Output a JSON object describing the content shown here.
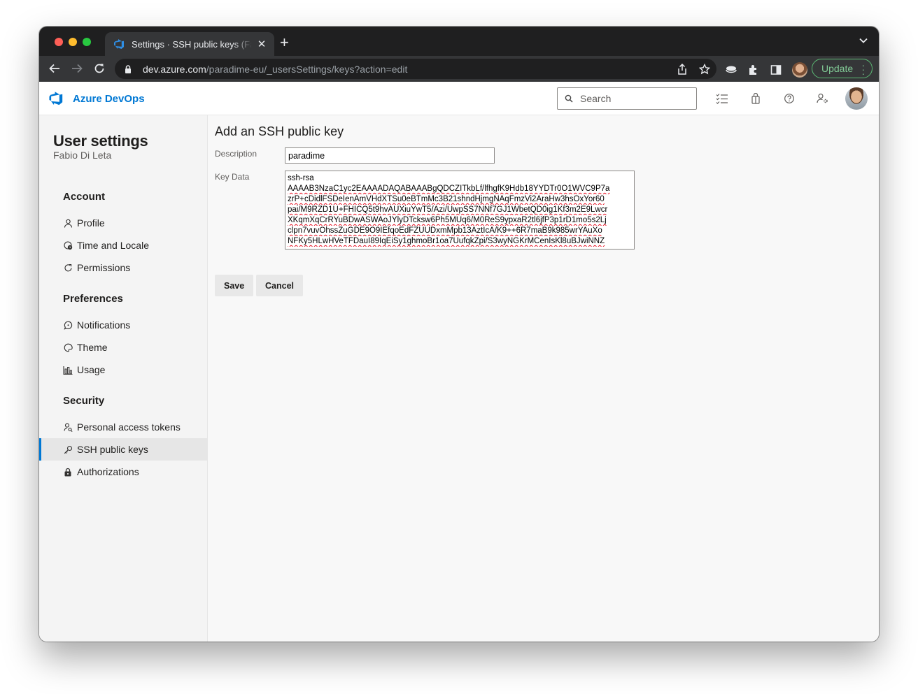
{
  "browser": {
    "tab_title": "Settings · SSH public keys (Fabio Di Leta)",
    "tab_close": "✕",
    "new_tab": "+",
    "url_host": "dev.azure.com",
    "url_path": "/paradime-eu/_usersSettings/keys?action=edit",
    "update_label": "Update"
  },
  "header": {
    "brand": "Azure DevOps",
    "search_placeholder": "Search",
    "accent": "#0078d4"
  },
  "sidebar": {
    "title": "User settings",
    "user": "Fabio Di Leta",
    "sections": {
      "account": "Account",
      "preferences": "Preferences",
      "security": "Security"
    },
    "items": {
      "profile": "Profile",
      "time_locale": "Time and Locale",
      "permissions": "Permissions",
      "notifications": "Notifications",
      "theme": "Theme",
      "usage": "Usage",
      "pat": "Personal access tokens",
      "ssh": "SSH public keys",
      "authorizations": "Authorizations"
    }
  },
  "main": {
    "title": "Add an SSH public key",
    "description_label": "Description",
    "description_value": "paradime",
    "key_label": "Key Data",
    "key_lines": [
      "ssh-rsa",
      "AAAAB3NzaC1yc2EAAAADAQABAAABgQDCZITkbLf/lfhgfK9Hdb18YYDTr0O1WVC9P7a",
      "zrP+cDidlFSDeIenAmVHdXTSu0eBTmMc3B21shndHjmgNAqFmzVi2AraHw3hsOxYor60",
      "pai/M9RZD1U+FHICQ5t9hvAUXiuYwT5/Azi/UwpSS7NNf7GJ1WbetQD0ig1Kf3m2E9Lwcr",
      "XKqmXqCrRYuBDwASWAoJYlyDTcksw6Ph5MUq6/M0ReS9ypxaR2tl6jfP3p1rD1mo5s2Lj",
      "clpn7vuvOhssZuGDE9O9IEfqoEdFZUUDxmMpb13AztIcA/K9++6R7maB9k985wrYAuXo",
      "NFKy5HLwHVeTFDauI89IqEiSy1ghmoBr1oa7UufqkZpi/S3wyNGKrMCenIsKl8uBJwiNNZ"
    ],
    "save_label": "Save",
    "cancel_label": "Cancel"
  }
}
